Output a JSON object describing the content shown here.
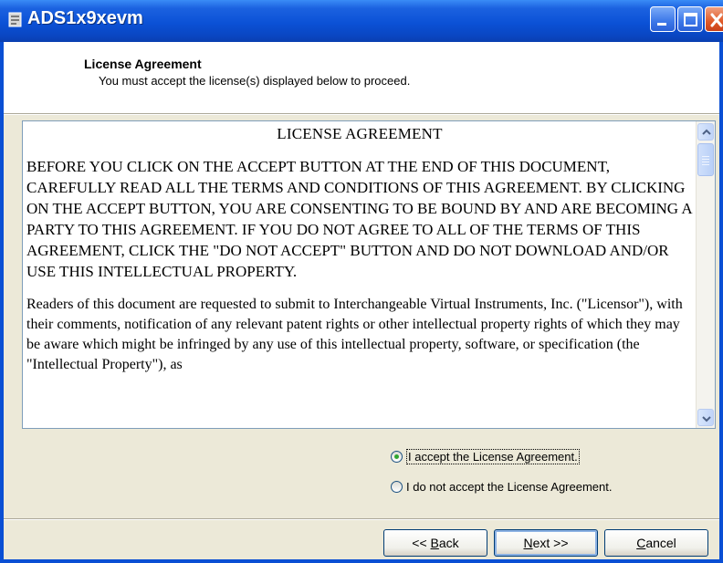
{
  "window": {
    "title": "ADS1x9xevm",
    "icon": "installer-app-icon",
    "controls": [
      "minimize-icon",
      "maximize-icon",
      "close-icon"
    ]
  },
  "header": {
    "title": "License Agreement",
    "subtitle": "You must accept the license(s) displayed below to proceed."
  },
  "license": {
    "heading": "LICENSE AGREEMENT",
    "paragraph1": "BEFORE YOU CLICK ON THE ACCEPT BUTTON AT THE END OF THIS DOCUMENT, CAREFULLY READ ALL THE TERMS AND CONDITIONS OF THIS AGREEMENT.  BY CLICKING ON THE ACCEPT BUTTON, YOU ARE CONSENTING TO BE BOUND BY AND ARE BECOMING A PARTY TO THIS AGREEMENT.  IF YOU DO NOT AGREE TO ALL OF THE TERMS OF THIS AGREEMENT, CLICK THE \"DO NOT ACCEPT\" BUTTON AND DO NOT DOWNLOAD AND/OR USE THIS INTELLECTUAL PROPERTY.",
    "paragraph2": "Readers of this document are requested to submit to Interchangeable Virtual Instruments, Inc. (\"Licensor\"), with their comments, notification of any relevant patent rights or other intellectual property rights of which they may be aware which might be infringed by any use of this intellectual property, software, or specification (the \"Intellectual Property\"), as"
  },
  "options": {
    "accept_label": "I accept the License Agreement.",
    "decline_label": "I do not accept the License Agreement.",
    "selected": "accept"
  },
  "buttons": {
    "back_mnemonic": "B",
    "back_rest": "ack",
    "back_prefix": "<< ",
    "next_mnemonic": "N",
    "next_rest": "ext >>",
    "cancel_mnemonic": "C",
    "cancel_rest": "ancel"
  },
  "colors": {
    "titlebar": "#0b51d6",
    "dialog_bg": "#ece9d8",
    "radio_selected": "#2fa52f"
  }
}
